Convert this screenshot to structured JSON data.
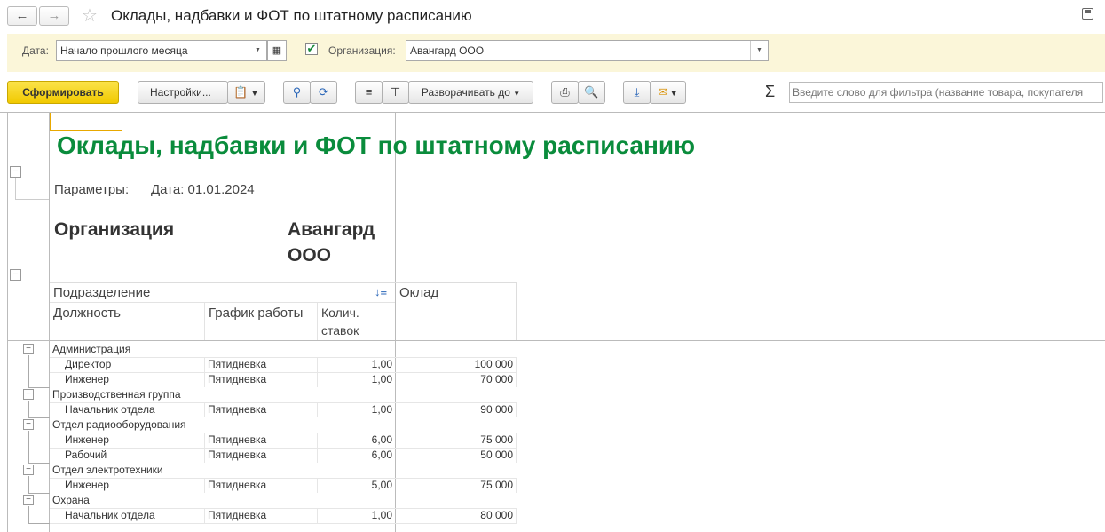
{
  "window": {
    "title": "Оклады, надбавки и ФОТ по штатному расписанию",
    "back": "🡐",
    "forward": "🡒",
    "star_icon": "star-icon",
    "save_icon": "save-icon"
  },
  "params": {
    "date_label": "Дата:",
    "date_value": "Начало прошлого месяца",
    "org_checkbox_checked": true,
    "org_label": "Организация:",
    "org_value": "Авангард ООО"
  },
  "toolbar": {
    "generate": "Сформировать",
    "settings": "Настройки...",
    "expand_to": "Разворачивать до",
    "sum_symbol": "Σ",
    "filter_placeholder": "Введите слово для фильтра (название товара, покупателя",
    "accent": "#f5d20a"
  },
  "report": {
    "title": "Оклады, надбавки и ФОТ по штатному расписанию",
    "params_label": "Параметры:",
    "params_value": "Дата: 01.01.2024",
    "org_label": "Организация",
    "org_value_line1": "Авангард",
    "org_value_line2": "ООО",
    "columns": {
      "department": "Подразделение",
      "position": "Должность",
      "schedule": "График работы",
      "rate_line1": "Колич.",
      "rate_line2": "ставок",
      "salary": "Оклад"
    },
    "rows": [
      {
        "type": "group",
        "name": "Администрация"
      },
      {
        "type": "item",
        "position": "Директор",
        "schedule": "Пятидневка",
        "rate": "1,00",
        "salary": "100 000"
      },
      {
        "type": "item",
        "position": "Инженер",
        "schedule": "Пятидневка",
        "rate": "1,00",
        "salary": "70 000"
      },
      {
        "type": "group",
        "name": "Производственная группа"
      },
      {
        "type": "item",
        "position": "Начальник отдела",
        "schedule": "Пятидневка",
        "rate": "1,00",
        "salary": "90 000"
      },
      {
        "type": "group",
        "name": "Отдел радиооборудования"
      },
      {
        "type": "item",
        "position": "Инженер",
        "schedule": "Пятидневка",
        "rate": "6,00",
        "salary": "75 000"
      },
      {
        "type": "item",
        "position": "Рабочий",
        "schedule": "Пятидневка",
        "rate": "6,00",
        "salary": "50 000"
      },
      {
        "type": "group",
        "name": "Отдел электротехники"
      },
      {
        "type": "item",
        "position": "Инженер",
        "schedule": "Пятидневка",
        "rate": "5,00",
        "salary": "75 000"
      },
      {
        "type": "group",
        "name": "Охрана"
      },
      {
        "type": "item",
        "position": "Начальник отдела",
        "schedule": "Пятидневка",
        "rate": "1,00",
        "salary": "80 000"
      }
    ],
    "title_color": "#0a8c3c"
  }
}
